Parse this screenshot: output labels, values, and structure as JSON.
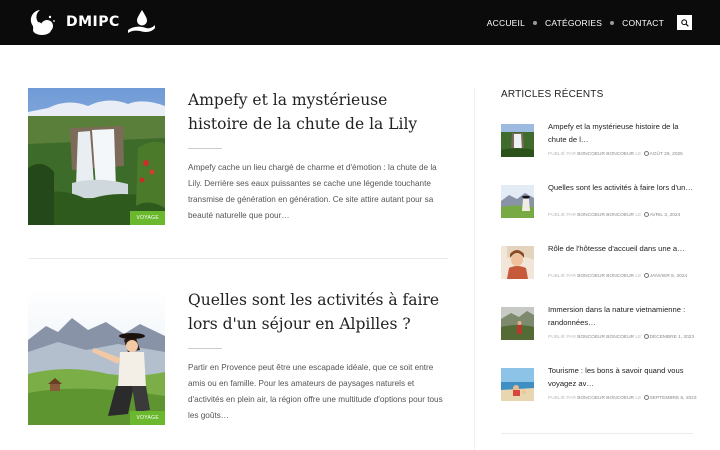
{
  "header": {
    "brand": "DMIPC",
    "nav": [
      "ACCUEIL",
      "CATÉGORIES",
      "CONTACT"
    ]
  },
  "posts": [
    {
      "title": "Ampefy et la mystérieuse histoire de la chute de la Lily",
      "excerpt": "Ampefy cache un lieu chargé de charme et d'émotion : la chute de la Lily. Derrière ses eaux puissantes se cache une légende touchante transmise de génération en génération. Ce site attire autant pour sa beauté naturelle que pour…",
      "badge": "VOYAGE"
    },
    {
      "title": "Quelles sont les activités à faire lors d'un séjour en Alpilles ?",
      "excerpt": "Partir en Provence peut être une escapade idéale, que ce soit entre amis ou en famille. Pour les amateurs de paysages naturels et d'activités en plein air, la région offre une multitude d'options pour tous les goûts…",
      "badge": "VOYAGE"
    }
  ],
  "sidebar": {
    "title": "ARTICLES RÉCENTS",
    "items": [
      {
        "title": "Ampefy et la mystérieuse histoire de la chute de l…",
        "published_label": "PUBLIÉ PAR",
        "author": "BONCOEUR BONCOEUR",
        "on": "LE",
        "date": "AOÛT 29, 2025"
      },
      {
        "title": "Quelles sont les activités à faire lors d'un…",
        "published_label": "PUBLIÉ PAR",
        "author": "BONCOEUR BONCOEUR",
        "on": "LE",
        "date": "AVRIL 3, 2024"
      },
      {
        "title": "Rôle de l'hôtesse d'accueil dans une a…",
        "published_label": "PUBLIÉ PAR",
        "author": "BONCOEUR BONCOEUR",
        "on": "LE",
        "date": "JANVIER 8, 2024"
      },
      {
        "title": "Immersion dans la nature vietnamienne : randonnées…",
        "published_label": "PUBLIÉ PAR",
        "author": "BONCOEUR BONCOEUR",
        "on": "LE",
        "date": "DÉCEMBRE 1, 2023"
      },
      {
        "title": "Tourisme : les bons à savoir quand vous voyagez av…",
        "published_label": "PUBLIÉ PAR",
        "author": "BONCOEUR BONCOEUR",
        "on": "LE",
        "date": "SEPTEMBRE 6, 2023"
      }
    ]
  },
  "icons": {
    "logo_left": "moon-cloud-icon",
    "logo_right": "drop-hand-icon",
    "search": "search-icon",
    "clock": "clock-icon"
  },
  "colors": {
    "header_bg": "#0b0b0b",
    "badge_bg": "#6ab82d"
  }
}
